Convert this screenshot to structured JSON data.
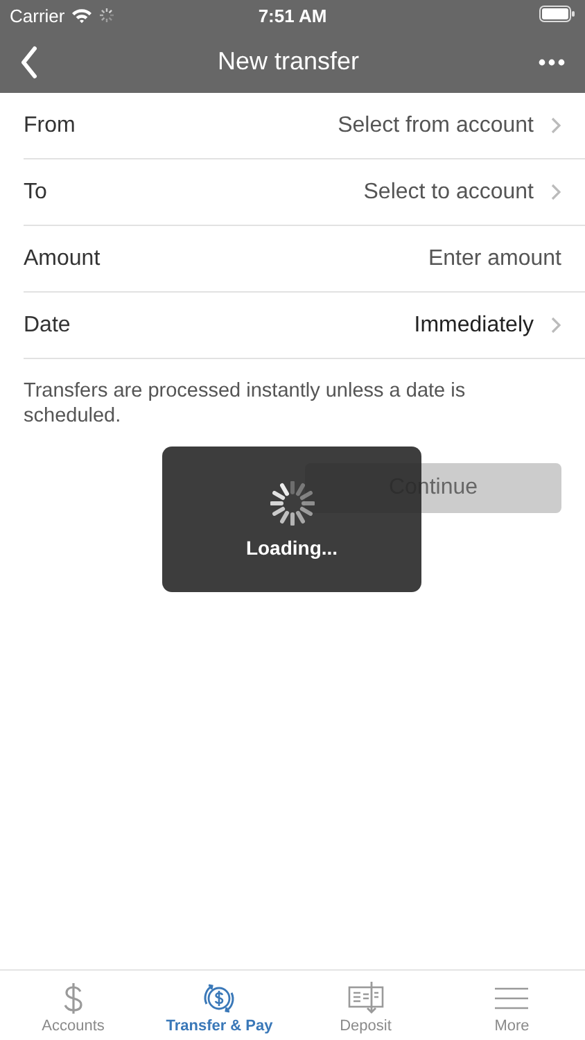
{
  "status_bar": {
    "carrier": "Carrier",
    "time": "7:51 AM"
  },
  "nav_bar": {
    "title": "New transfer"
  },
  "fields": [
    {
      "label": "From",
      "kind": "select",
      "placeholder": "Select from account"
    },
    {
      "label": "To",
      "kind": "select",
      "placeholder": "Select to account"
    },
    {
      "label": "Amount",
      "kind": "input",
      "placeholder": "Enter amount"
    },
    {
      "label": "Date",
      "kind": "select",
      "value": "Immediately"
    }
  ],
  "note": "Transfers are processed instantly unless a date is scheduled.",
  "continue_button": {
    "label": "Continue",
    "disabled": true
  },
  "loading": {
    "text": "Loading..."
  },
  "tab_bar": [
    {
      "label": "Accounts",
      "kind": "accounts",
      "selected": false
    },
    {
      "label": "Transfer & Pay",
      "kind": "transfer",
      "selected": true
    },
    {
      "label": "Deposit",
      "kind": "deposit",
      "selected": false
    },
    {
      "label": "More",
      "kind": "more",
      "selected": false
    }
  ]
}
